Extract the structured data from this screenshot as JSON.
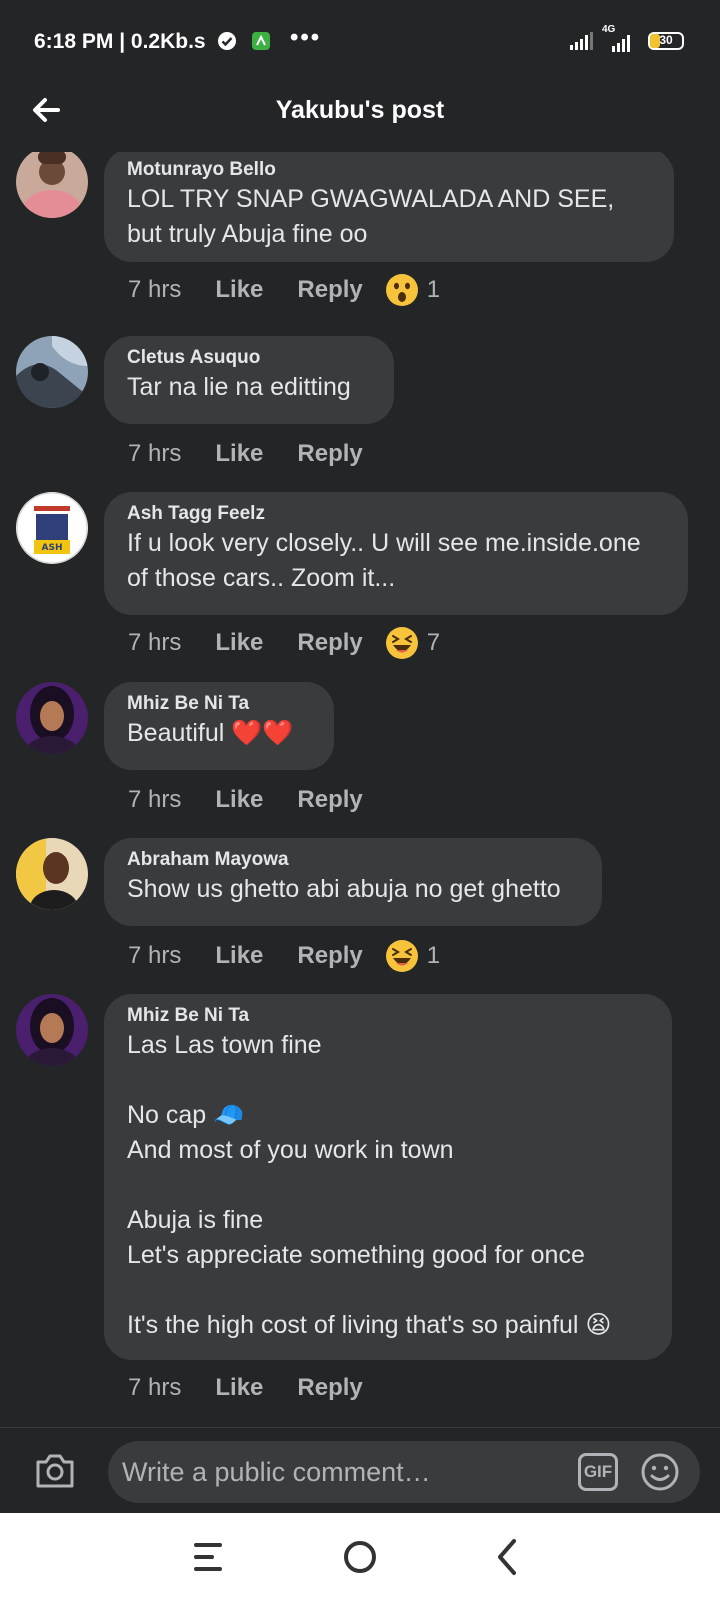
{
  "status_bar": {
    "time_speed": "6:18 PM | 0.2Kb.s",
    "dots": "•••",
    "network_label": "4G",
    "battery": "30"
  },
  "header": {
    "title": "Yakubu's post"
  },
  "comments": [
    {
      "author": "Motunrayo Bello",
      "text": "LOL TRY SNAP GWAGWALADA AND SEE, but truly Abuja fine oo",
      "time": "7 hrs",
      "like": "Like",
      "reply": "Reply",
      "reaction": "wow-emoji",
      "reaction_count": "1"
    },
    {
      "author": "Cletus Asuquo",
      "text": "Tar na lie na editting",
      "time": "7 hrs",
      "like": "Like",
      "reply": "Reply"
    },
    {
      "author": "Ash Tagg Feelz",
      "text": "If u look very closely.. U will see me.inside.one of those cars.. Zoom it...",
      "time": "7 hrs",
      "like": "Like",
      "reply": "Reply",
      "reaction": "laughing-emoji",
      "reaction_count": "7"
    },
    {
      "author": "Mhiz Be Ni Ta",
      "text": "Beautiful ❤️❤️",
      "time": "7 hrs",
      "like": "Like",
      "reply": "Reply"
    },
    {
      "author": "Abraham Mayowa",
      "text": "Show us ghetto abi abuja no get ghetto",
      "time": "7 hrs",
      "like": "Like",
      "reply": "Reply",
      "reaction": "laughing-emoji",
      "reaction_count": "1"
    },
    {
      "author": "Mhiz Be Ni Ta",
      "text": "Las Las town fine\n\nNo cap 🧢\nAnd most of you work in town\n\nAbuja is fine\nLet's appreciate something good for once\n\nIt's the high cost of living that's so painful 😫",
      "time": "7 hrs",
      "like": "Like",
      "reply": "Reply"
    }
  ],
  "composer": {
    "placeholder": "Write a public comment…",
    "gif_label": "GIF"
  },
  "colors": {
    "background": "#242526",
    "bubble": "#3a3b3c",
    "primary_text": "#e4e6eb",
    "secondary_text": "#b0b3b8",
    "nav_bar": "#ffffff"
  },
  "icons": [
    "back-arrow-icon",
    "camera-icon",
    "gif-icon",
    "smile-icon",
    "recents-icon",
    "home-icon",
    "back-icon"
  ]
}
